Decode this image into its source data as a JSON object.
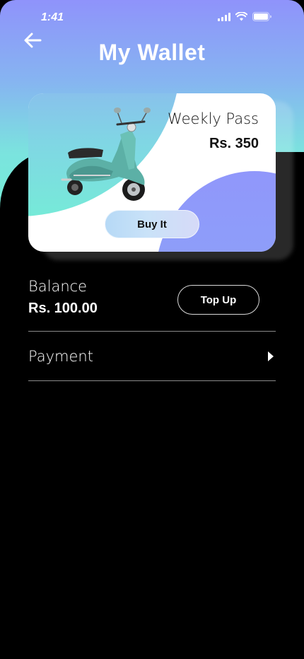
{
  "status_bar": {
    "time": "1:41"
  },
  "header": {
    "title": "My Wallet"
  },
  "pass_card": {
    "name": "Weekly Pass",
    "price": "Rs. 350",
    "button_label": "Buy It"
  },
  "balance": {
    "label": "Balance",
    "amount": "Rs. 100.00",
    "topup_label": "Top Up"
  },
  "payment": {
    "label": "Payment"
  },
  "colors": {
    "gradient_top": "#8f93fb",
    "gradient_mid": "#86b4f1",
    "gradient_bottom": "#74f0d8",
    "card_purple": "#9097fb",
    "background": "#000000"
  },
  "icons": {
    "back": "arrow-left-icon",
    "payment_chevron": "chevron-right-icon",
    "signal": "cellular-signal-icon",
    "wifi": "wifi-icon",
    "battery": "battery-icon"
  }
}
